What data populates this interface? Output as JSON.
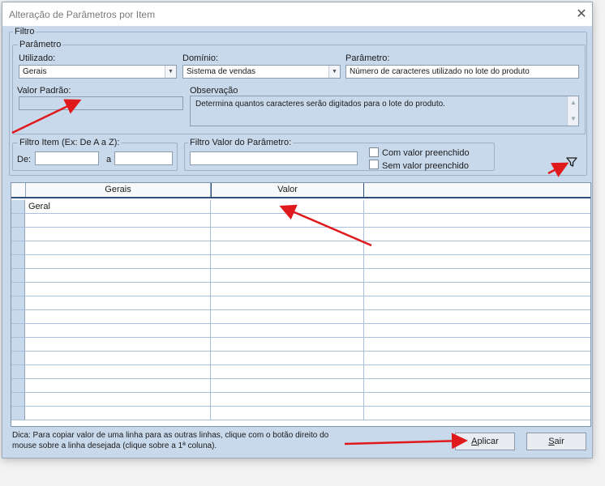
{
  "window": {
    "title": "Alteração de Parâmetros por Item",
    "close_glyph": "✕"
  },
  "filtro": {
    "legend": "Filtro",
    "parametro_group": {
      "legend": "Parâmetro",
      "utilizado": {
        "label": "Utilizado:",
        "value": "Gerais"
      },
      "dominio": {
        "label": "Domínio:",
        "value": "Sistema de vendas"
      },
      "parametro": {
        "label": "Parâmetro:",
        "value": "Número de caracteres utilizado no lote do produto"
      },
      "valor_padrao": {
        "label": "Valor Padrão:",
        "value": ""
      },
      "observacao": {
        "label": "Observação",
        "value": "Determina quantos caracteres serão digitados para o lote do produto."
      }
    },
    "filtro_item": {
      "legend": "Filtro Item (Ex: De A a Z):",
      "de_label": "De:",
      "a_label": "a",
      "de_value": "",
      "a_value": ""
    },
    "filtro_valor": {
      "legend": "Filtro Valor do Parâmetro:",
      "value": "",
      "com_valor": "Com valor preenchido",
      "sem_valor": "Sem valor preenchido"
    }
  },
  "grid": {
    "headers": [
      "Gerais",
      "Valor",
      ""
    ],
    "rows": [
      [
        "Geral",
        "",
        ""
      ],
      [
        "",
        "",
        ""
      ],
      [
        "",
        "",
        ""
      ],
      [
        "",
        "",
        ""
      ],
      [
        "",
        "",
        ""
      ],
      [
        "",
        "",
        ""
      ],
      [
        "",
        "",
        ""
      ],
      [
        "",
        "",
        ""
      ],
      [
        "",
        "",
        ""
      ],
      [
        "",
        "",
        ""
      ],
      [
        "",
        "",
        ""
      ],
      [
        "",
        "",
        ""
      ],
      [
        "",
        "",
        ""
      ],
      [
        "",
        "",
        ""
      ],
      [
        "",
        "",
        ""
      ],
      [
        "",
        "",
        ""
      ]
    ]
  },
  "footer": {
    "hint": "Dica: Para copiar valor de uma linha para as outras linhas, clique com o botão direito do mouse sobre a linha desejada (clique sobre a 1ª coluna).",
    "aplicar_underline": "A",
    "aplicar_rest": "plicar",
    "sair_underline": "S",
    "sair_rest": "air"
  },
  "colors": {
    "annotation_arrow": "#e0191c",
    "window_bg": "#c9d9ec"
  },
  "icons": [
    "close-icon",
    "filter-icon",
    "chevron-down-icon"
  ]
}
